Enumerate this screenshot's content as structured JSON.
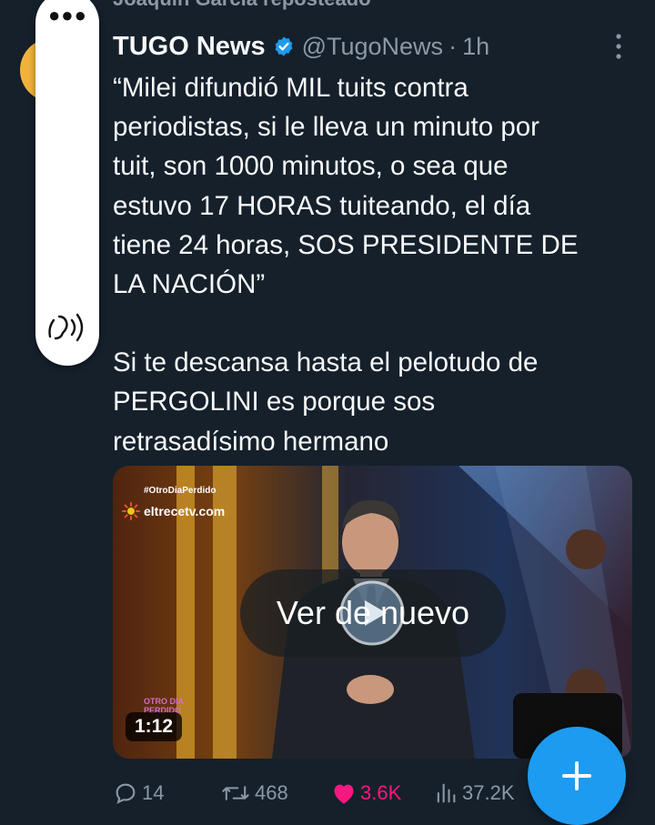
{
  "reposted_by": "Joaquín García reposteado",
  "tweet": {
    "author_name": "TUGO News",
    "handle": "@TugoNews",
    "separator": "·",
    "time": "1h",
    "text_lines": [
      "“Milei difundió MIL tuits contra",
      "periodistas, si le lleva un minuto por",
      "tuit, son 1000 minutos, o sea que",
      "estuvo 17 HORAS tuiteando, el día",
      "tiene 24 horas, SOS PRESIDENTE DE",
      "LA NACIÓN”"
    ],
    "text_lines_2": [
      "Si te descansa hasta el pelotudo de",
      "PERGOLINI es porque sos",
      "retrasadísimo hermano"
    ]
  },
  "media": {
    "hashtag": "#OtroDiaPerdido",
    "channel": "eltrecetv.com",
    "replay_label": "Ver de nuevo",
    "duration": "1:12",
    "watermark_line1": "OTRO DIA",
    "watermark_line2": "PERDIDO"
  },
  "actions": {
    "replies": "14",
    "reposts": "468",
    "likes": "3.6K",
    "views": "37.2K"
  },
  "colors": {
    "background": "#15202b",
    "accent": "#1d9bf0",
    "like": "#f91880",
    "muted": "#8b98a5"
  },
  "icons": {
    "verified": "verified-badge-icon",
    "more": "more-vertical-icon",
    "reply": "reply-icon",
    "repost": "repost-icon",
    "like": "heart-icon",
    "views": "views-icon",
    "compose": "plus-icon",
    "play": "play-icon",
    "sound": "sound-icon",
    "panel_more": "more-horizontal-icon"
  }
}
